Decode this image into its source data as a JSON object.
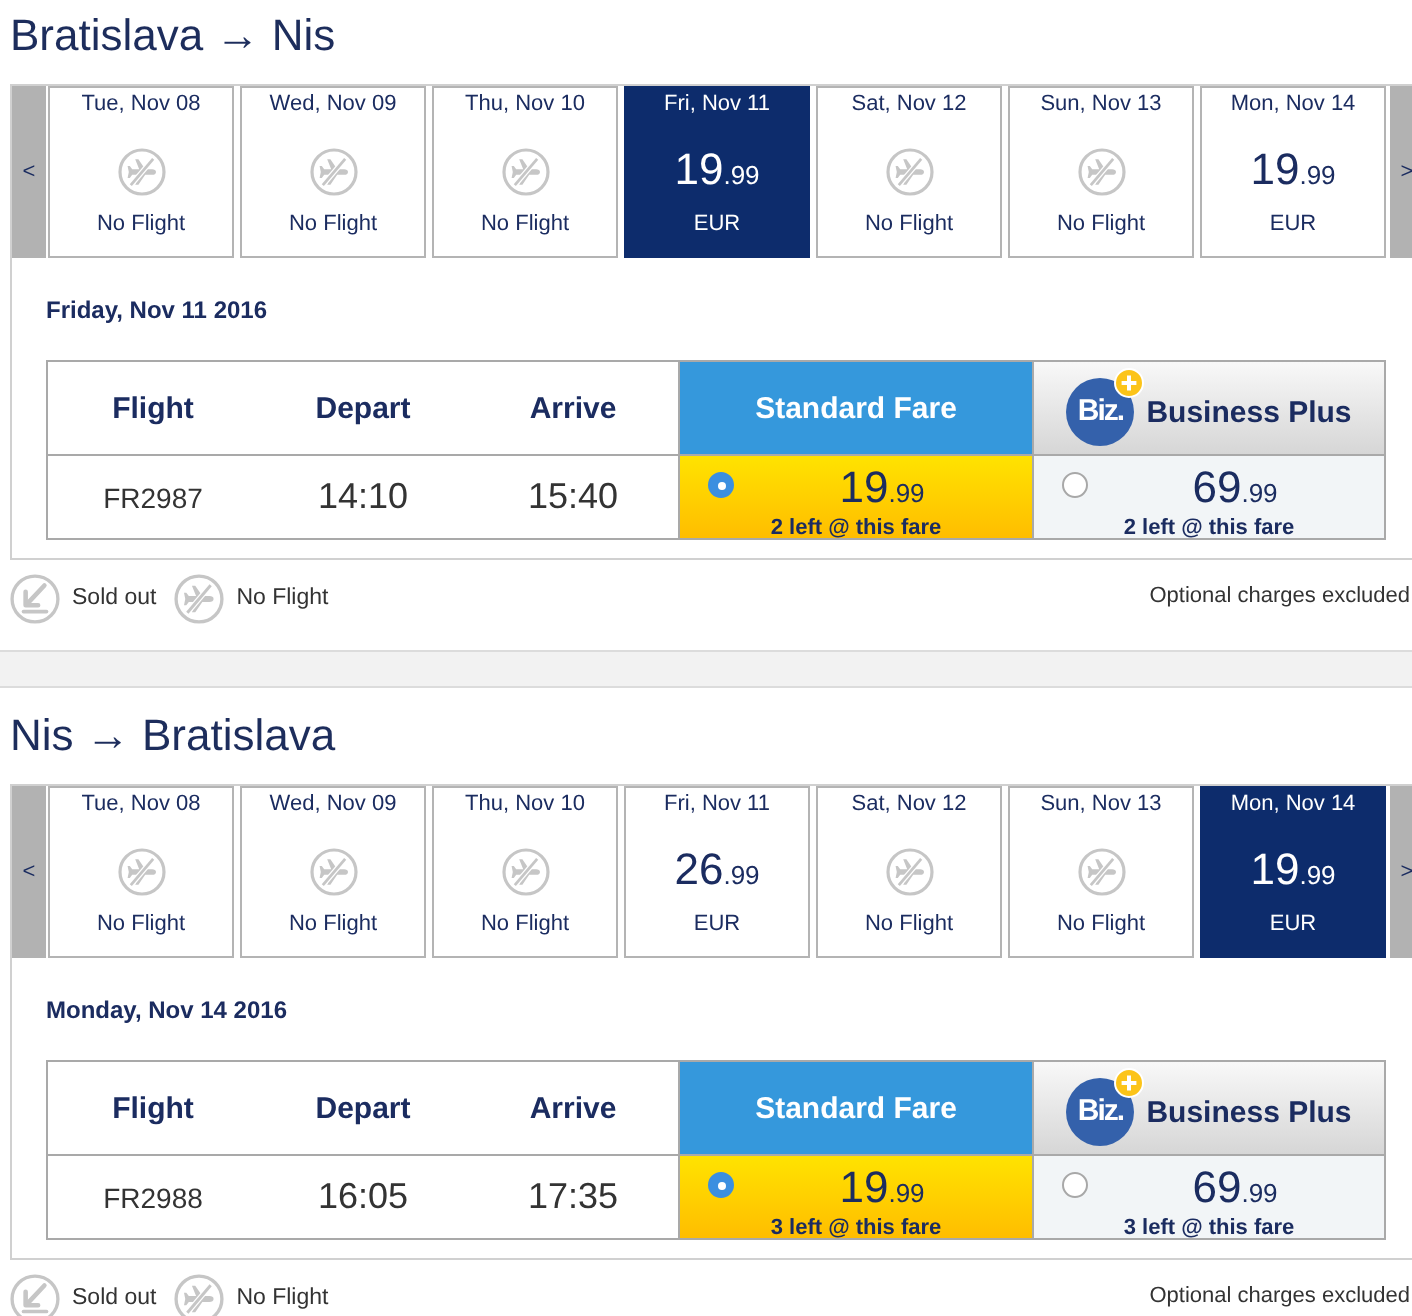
{
  "journeys": [
    {
      "title": "Bratislava → Nis",
      "prev_button": "<",
      "next_button": ">",
      "days": [
        {
          "date": "Tue, Nov 08",
          "kind": "no_flight",
          "label": "No Flight",
          "selected": false
        },
        {
          "date": "Wed, Nov 09",
          "kind": "no_flight",
          "label": "No Flight",
          "selected": false
        },
        {
          "date": "Thu, Nov 10",
          "kind": "no_flight",
          "label": "No Flight",
          "selected": false
        },
        {
          "date": "Fri, Nov 11",
          "kind": "fare",
          "price": "19.99",
          "currency": "EUR",
          "selected": true
        },
        {
          "date": "Sat, Nov 12",
          "kind": "no_flight",
          "label": "No Flight",
          "selected": false
        },
        {
          "date": "Sun, Nov 13",
          "kind": "no_flight",
          "label": "No Flight",
          "selected": false
        },
        {
          "date": "Mon, Nov 14",
          "kind": "fare",
          "price": "19.99",
          "currency": "EUR",
          "selected": false
        }
      ],
      "date_heading": "Friday, Nov 11 2016",
      "table": {
        "columns": [
          "Flight",
          "Depart",
          "Arrive"
        ],
        "fare_columns": [
          {
            "kind": "standard",
            "label": "Standard Fare"
          },
          {
            "kind": "business",
            "logo": "Biz.",
            "label": "Business Plus"
          }
        ],
        "rows": [
          {
            "flight": "FR2987",
            "depart": "14:10",
            "arrive": "15:40",
            "fares": [
              {
                "price": "19.99",
                "availability": "2 left @ this fare",
                "selected": true
              },
              {
                "price": "69.99",
                "availability": "2 left @ this fare",
                "selected": false
              }
            ]
          }
        ]
      },
      "legend": [
        {
          "kind": "sold_out",
          "label": "Sold out"
        },
        {
          "kind": "no_flight",
          "label": "No Flight"
        }
      ],
      "note": "Optional charges excluded"
    },
    {
      "title": "Nis → Bratislava",
      "prev_button": "<",
      "next_button": ">",
      "days": [
        {
          "date": "Tue, Nov 08",
          "kind": "no_flight",
          "label": "No Flight",
          "selected": false
        },
        {
          "date": "Wed, Nov 09",
          "kind": "no_flight",
          "label": "No Flight",
          "selected": false
        },
        {
          "date": "Thu, Nov 10",
          "kind": "no_flight",
          "label": "No Flight",
          "selected": false
        },
        {
          "date": "Fri, Nov 11",
          "kind": "fare",
          "price": "26.99",
          "currency": "EUR",
          "selected": false
        },
        {
          "date": "Sat, Nov 12",
          "kind": "no_flight",
          "label": "No Flight",
          "selected": false
        },
        {
          "date": "Sun, Nov 13",
          "kind": "no_flight",
          "label": "No Flight",
          "selected": false
        },
        {
          "date": "Mon, Nov 14",
          "kind": "fare",
          "price": "19.99",
          "currency": "EUR",
          "selected": true
        }
      ],
      "date_heading": "Monday, Nov 14 2016",
      "table": {
        "columns": [
          "Flight",
          "Depart",
          "Arrive"
        ],
        "fare_columns": [
          {
            "kind": "standard",
            "label": "Standard Fare"
          },
          {
            "kind": "business",
            "logo": "Biz.",
            "label": "Business Plus"
          }
        ],
        "rows": [
          {
            "flight": "FR2988",
            "depart": "16:05",
            "arrive": "17:35",
            "fares": [
              {
                "price": "19.99",
                "availability": "3 left @ this fare",
                "selected": true
              },
              {
                "price": "69.99",
                "availability": "3 left @ this fare",
                "selected": false
              }
            ]
          }
        ]
      },
      "legend": [
        {
          "kind": "sold_out",
          "label": "Sold out"
        },
        {
          "kind": "no_flight",
          "label": "No Flight"
        }
      ],
      "note": "Optional charges excluded"
    }
  ]
}
